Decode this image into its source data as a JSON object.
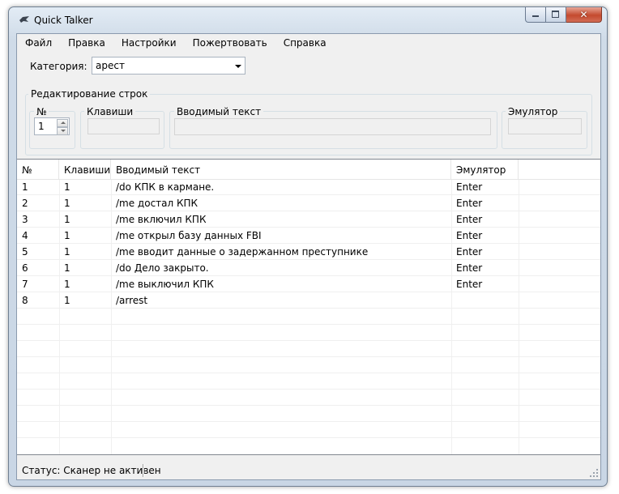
{
  "window": {
    "title": "Quick Talker",
    "close_glyph": "✕"
  },
  "menu": [
    "Файл",
    "Правка",
    "Настройки",
    "Пожертвовать",
    "Справка"
  ],
  "category": {
    "label": "Категория:",
    "value": "арест"
  },
  "editor": {
    "group_title": "Редактирование строк",
    "num_title": "№",
    "num_value": "1",
    "keys_title": "Клавиши",
    "keys_value": "",
    "text_title": "Вводимый текст",
    "text_value": "",
    "emu_title": "Эмулятор",
    "emu_value": ""
  },
  "table": {
    "columns": [
      "№",
      "Клавиши",
      "Вводимый текст",
      "Эмулятор"
    ],
    "rows": [
      [
        "1",
        "1",
        "/do КПК в кармане.",
        "Enter"
      ],
      [
        "2",
        "1",
        "/me достал КПК",
        "Enter"
      ],
      [
        "3",
        "1",
        "/me включил КПК",
        "Enter"
      ],
      [
        "4",
        "1",
        "/me открыл базу данных FBI",
        "Enter"
      ],
      [
        "5",
        "1",
        "/me вводит данные о задержанном преступнике",
        "Enter"
      ],
      [
        "6",
        "1",
        "/do Дело закрыто.",
        "Enter"
      ],
      [
        "7",
        "1",
        "/me выключил КПК",
        "Enter"
      ],
      [
        "8",
        "1",
        "/arrest",
        ""
      ]
    ],
    "empty_rows": 8
  },
  "status": {
    "text": "Статус: Сканер не активен"
  },
  "icons": {
    "app": "app-icon",
    "minimize": "minimize-icon",
    "maximize": "maximize-icon",
    "close": "close-icon",
    "dropdown": "chevron-down-icon",
    "spin_up": "spin-up-icon",
    "spin_down": "spin-down-icon",
    "grip": "resize-grip-icon"
  }
}
